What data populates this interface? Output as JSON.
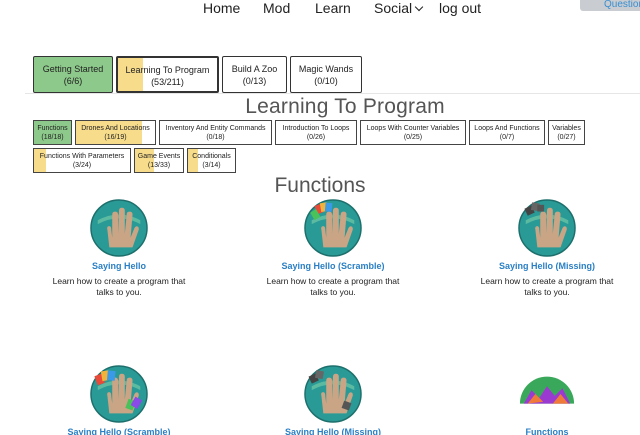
{
  "nav": {
    "home": "Home",
    "mod": "Mod",
    "learn": "Learn",
    "social": "Social",
    "logout": "log out",
    "questions": "Questions"
  },
  "courses": [
    {
      "label": "Getting Started",
      "count": "(6/6)",
      "progress": 1.0
    },
    {
      "label": "Learning To Program",
      "count": "(53/211)",
      "progress": 0.25
    },
    {
      "label": "Build A Zoo",
      "count": "(0/13)",
      "progress": 0
    },
    {
      "label": "Magic Wands",
      "count": "(0/10)",
      "progress": 0
    }
  ],
  "course_title": "Learning To Program",
  "units": [
    {
      "label": "Functions",
      "count": "(18/18)",
      "progress": 1.0
    },
    {
      "label": "Drones And Locations",
      "count": "(16/19)",
      "progress": 0.84
    },
    {
      "label": "Inventory And Entity Commands",
      "count": "(0/18)",
      "progress": 0
    },
    {
      "label": "Introduction To Loops",
      "count": "(0/26)",
      "progress": 0
    },
    {
      "label": "Loops With Counter Variables",
      "count": "(0/25)",
      "progress": 0
    },
    {
      "label": "Loops And Functions",
      "count": "(0/7)",
      "progress": 0
    },
    {
      "label": "Variables",
      "count": "(0/27)",
      "progress": 0
    },
    {
      "label": "Functions With Parameters",
      "count": "(3/24)",
      "progress": 0.125
    },
    {
      "label": "Game Events",
      "count": "(13/33)",
      "progress": 0.39
    },
    {
      "label": "Conditionals",
      "count": "(3/14)",
      "progress": 0.21
    }
  ],
  "unit_title": "Functions",
  "lessons": [
    {
      "name": "Saying Hello",
      "desc": "Learn how to create a program that talks to you.",
      "icon": "hand-icon"
    },
    {
      "name": "Saying Hello (Scramble)",
      "desc": "Learn how to create a program that talks to you.",
      "icon": "hand-scramble-icon"
    },
    {
      "name": "Saying Hello (Missing)",
      "desc": "Learn how to create a program that talks to you.",
      "icon": "hand-missing-icon"
    },
    {
      "name": "Saying Hello (Scramble)",
      "desc": "",
      "icon": "hand-scramble-icon"
    },
    {
      "name": "Saying Hello (Missing)",
      "desc": "",
      "icon": "hand-missing-icon"
    },
    {
      "name": "Functions",
      "desc": "",
      "icon": "functions-icon"
    }
  ],
  "colors": {
    "completed": "#8dc98a",
    "in_progress": "#f7dc8c",
    "link": "#2a7fc4",
    "globe_teal": "#2a9a96"
  }
}
